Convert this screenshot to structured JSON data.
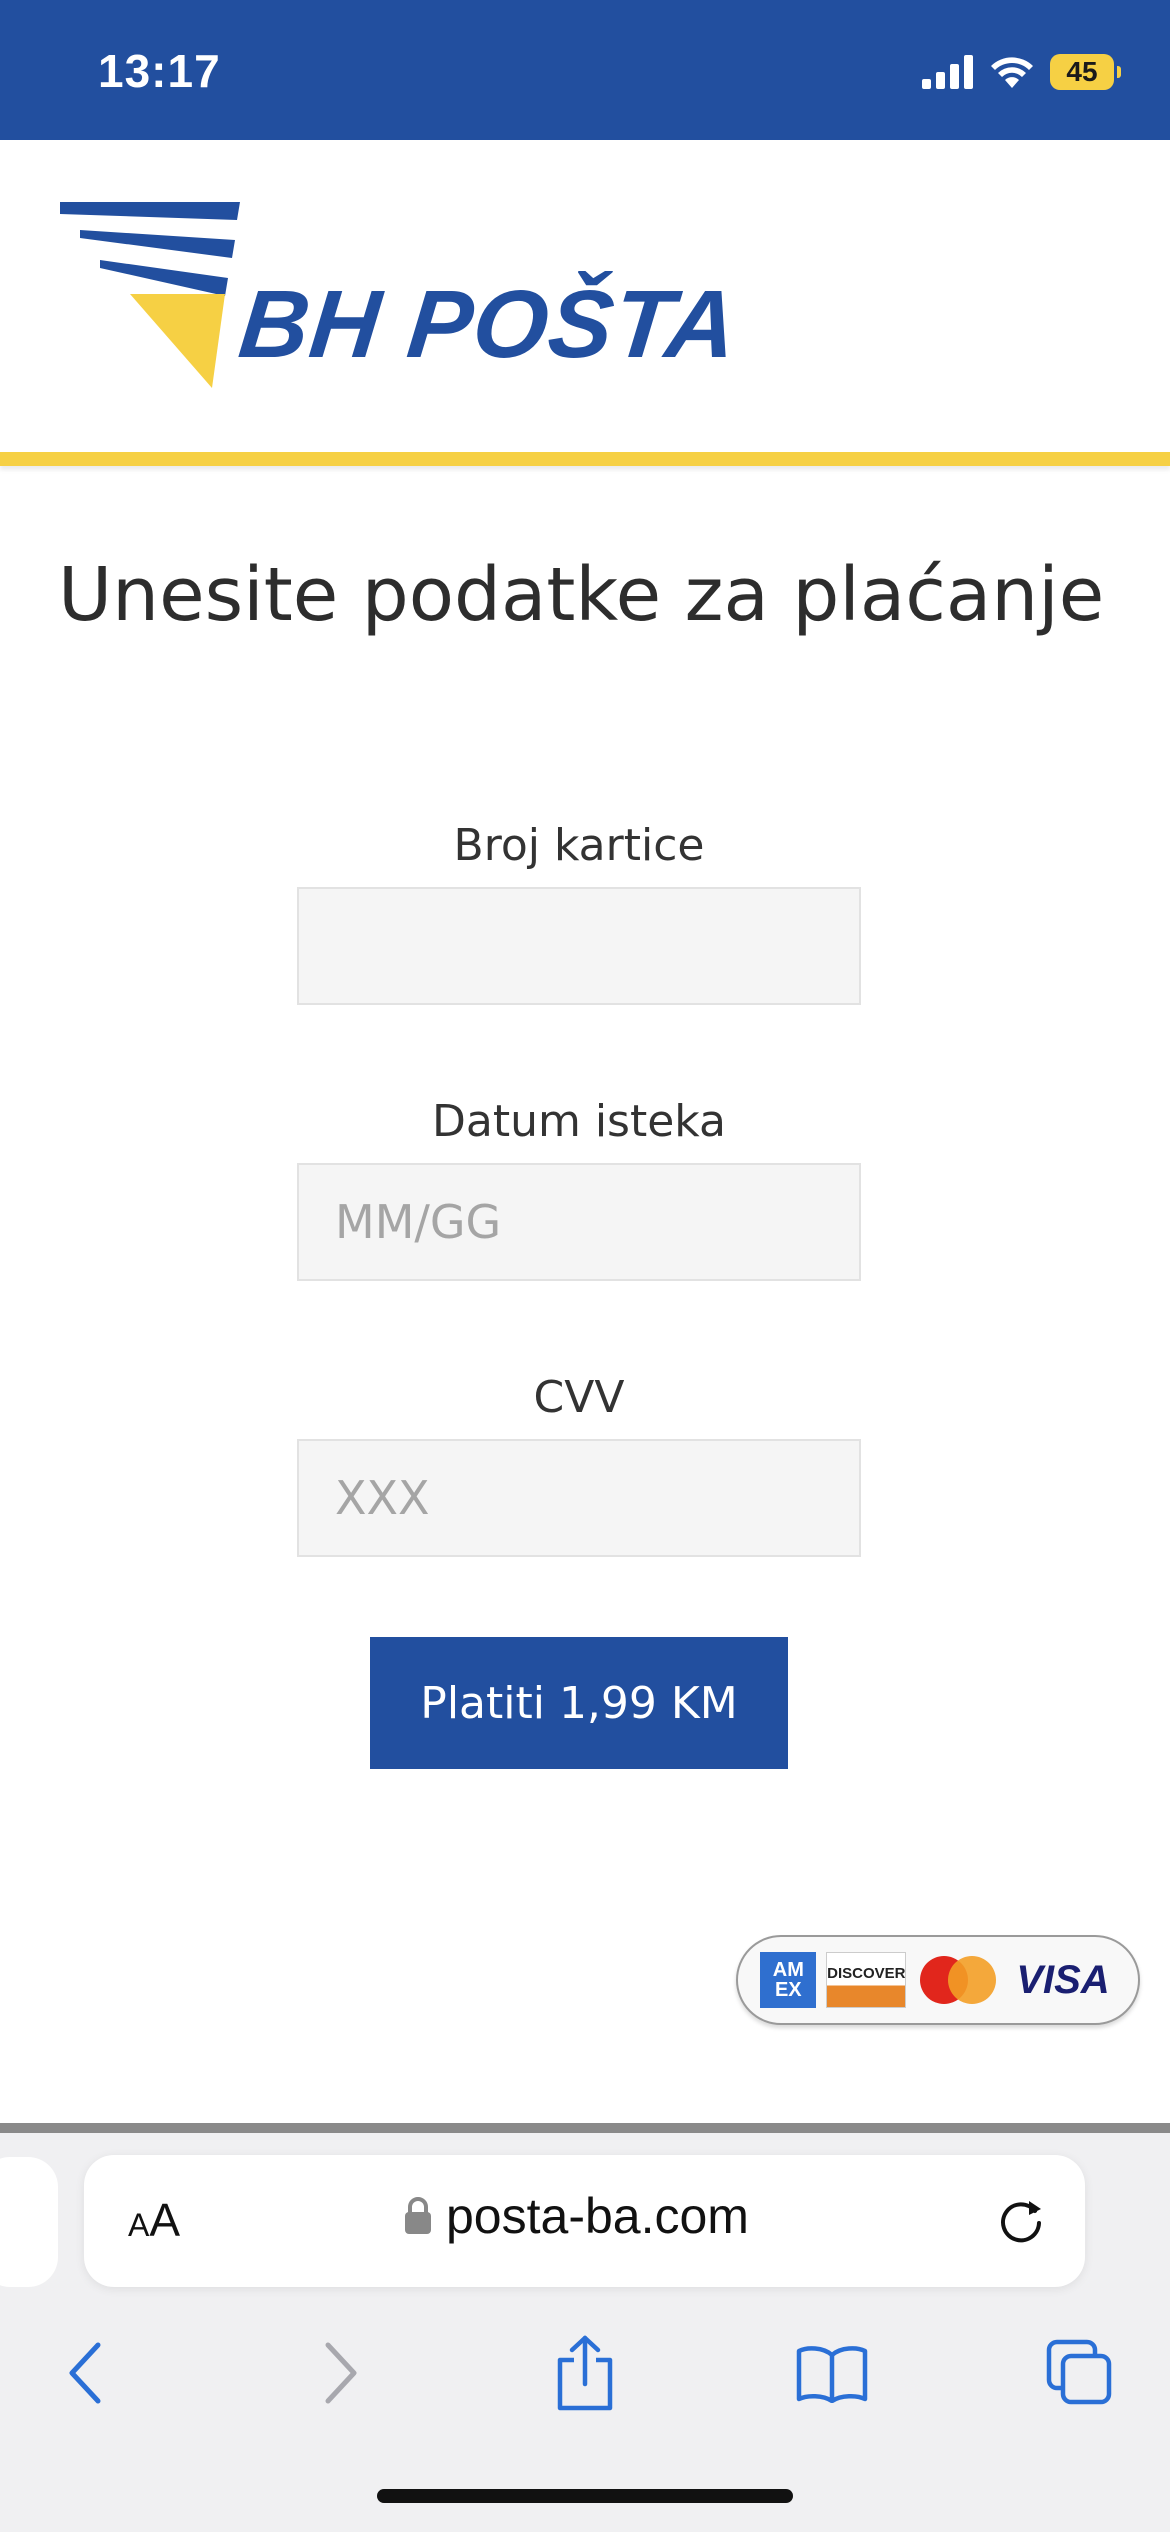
{
  "status_bar": {
    "time": "13:17",
    "battery": "45",
    "background": "#224f9f"
  },
  "header": {
    "logo_text": "BH POŠTA",
    "brand_blue": "#224f9f",
    "brand_yellow": "#f6d044"
  },
  "page": {
    "title": "Unesite podatke za plaćanje"
  },
  "form": {
    "card_number": {
      "label": "Broj kartice",
      "value": "",
      "placeholder": ""
    },
    "expiry": {
      "label": "Datum isteka",
      "value": "",
      "placeholder": "MM/GG"
    },
    "cvv": {
      "label": "CVV",
      "value": "",
      "placeholder": "XXX"
    },
    "pay_button": "Platiti 1,99 KM"
  },
  "card_logos": {
    "amex": "AM EX",
    "discover": "DISCOVER",
    "visa": "VISA"
  },
  "browser": {
    "text_size_button": "AA",
    "url": "posta-ba.com",
    "icons": [
      "lock-icon",
      "reload-icon",
      "back-icon",
      "forward-icon",
      "share-icon",
      "bookmarks-icon",
      "tabs-icon"
    ]
  }
}
